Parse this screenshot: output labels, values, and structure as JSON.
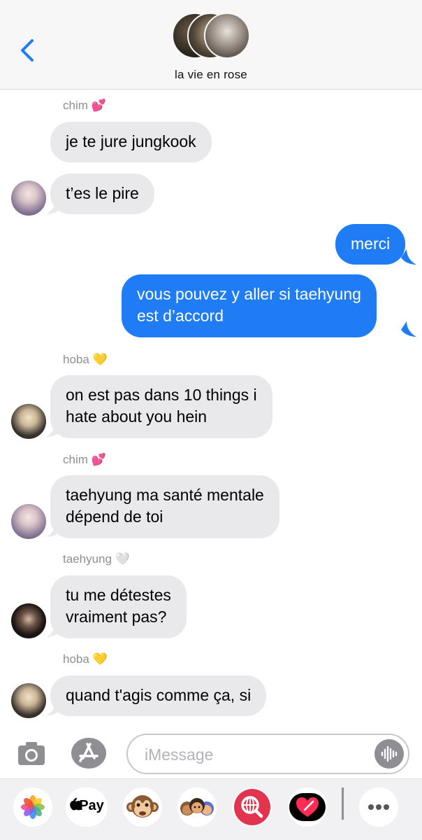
{
  "header": {
    "group_name": "la vie en rose"
  },
  "messages": [
    {
      "type": "sender",
      "name": "chim",
      "emoji": "💕"
    },
    {
      "type": "in",
      "text": "je te jure jungkook"
    },
    {
      "type": "in",
      "text": "t’es le pire",
      "avatar": "chim"
    },
    {
      "type": "out",
      "text": "merci"
    },
    {
      "type": "out",
      "lines": [
        "vous pouvez y aller si taehyung",
        "est d’accord"
      ]
    },
    {
      "type": "sender",
      "name": "hoba",
      "emoji": "💛"
    },
    {
      "type": "in",
      "lines": [
        "on est pas dans 10 things i",
        "hate about you hein"
      ],
      "avatar": "hoba"
    },
    {
      "type": "sender",
      "name": "chim",
      "emoji": "💕"
    },
    {
      "type": "in",
      "lines": [
        "taehyung ma santé mentale",
        "dépend de toi"
      ],
      "avatar": "chim"
    },
    {
      "type": "sender",
      "name": "taehyung",
      "emoji": "🤍"
    },
    {
      "type": "in",
      "lines": [
        "tu me détestes",
        "vraiment pas?"
      ],
      "avatar": "taehyung"
    },
    {
      "type": "sender",
      "name": "hoba",
      "emoji": "💛"
    },
    {
      "type": "in",
      "text": "quand t'agis comme ça, si",
      "avatar": "hoba"
    }
  ],
  "input": {
    "placeholder": "iMessage"
  },
  "drawer": {
    "apple_pay_label": "Pay",
    "icons": [
      "photos-icon",
      "apple-pay-icon",
      "monkey-memoji-icon",
      "memoji-stickers-icon",
      "web-search-icon",
      "digital-touch-icon",
      "more-apps-icon"
    ]
  },
  "colors": {
    "outgoing_bubble": "#1f7cf5",
    "incoming_bubble": "#e9e9eb",
    "accent": "#1f7cf5"
  }
}
